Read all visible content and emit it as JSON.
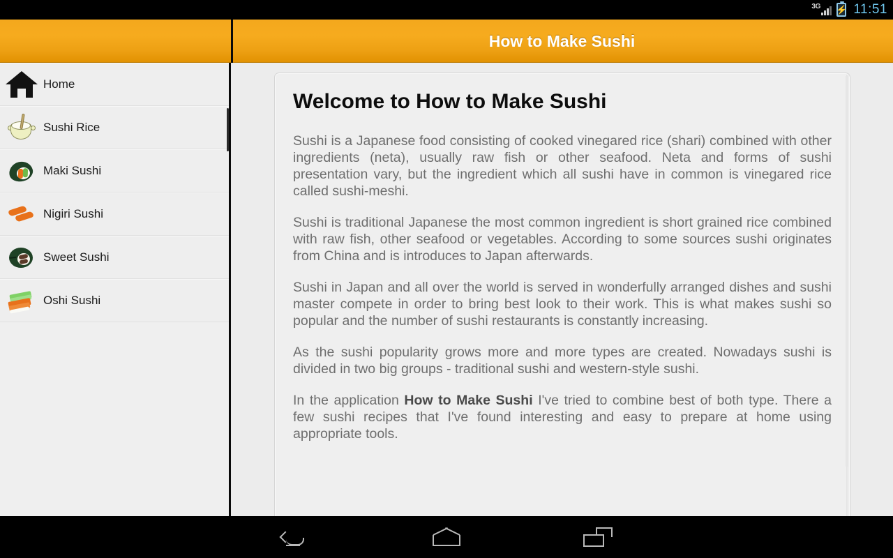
{
  "statusbar": {
    "network_label": "3G",
    "signal_icon": "signal-bars-icon",
    "battery_icon": "battery-charging-icon",
    "battery_bolt": "⚡",
    "time": "11:51"
  },
  "actionbar": {
    "title": "How to Make Sushi",
    "bg_color": "#f4a81d",
    "title_color": "#ffffff"
  },
  "drawer": {
    "items": [
      {
        "label": "Home",
        "icon": "home-icon"
      },
      {
        "label": "Sushi Rice",
        "icon": "rice-bowl-icon"
      },
      {
        "label": "Maki Sushi",
        "icon": "maki-roll-icon"
      },
      {
        "label": "Nigiri Sushi",
        "icon": "nigiri-salmon-icon"
      },
      {
        "label": "Sweet Sushi",
        "icon": "sweet-roll-icon"
      },
      {
        "label": "Oshi Sushi",
        "icon": "oshi-layers-icon"
      }
    ]
  },
  "main": {
    "doc_title": "Welcome to How to Make Sushi",
    "paragraphs": [
      "Sushi is a Japanese food consisting of cooked vinegared rice (shari) combined with other ingredients (neta), usually raw fish or other seafood. Neta and forms of sushi presentation vary, but the ingredient which all sushi have in common is vinegared rice called sushi-meshi.",
      "Sushi is traditional Japanese the most common ingredient is short grained rice combined with raw fish, other seafood or vegetables. According to some sources sushi originates from China and is introduces to Japan afterwards.",
      "Sushi in Japan and all over the world is served in wonderfully arranged dishes and sushi master compete in order to bring best look to their work. This is what makes sushi so popular and the number of sushi restaurants is constantly increasing.",
      "As the sushi popularity grows more and more types are created. Nowadays sushi is divided in two big groups - traditional sushi and western-style sushi."
    ],
    "last_paragraph": {
      "before": "In the application ",
      "bold": "How to Make Sushi",
      "after": " I've tried to combine best of both type. There a few sushi recipes that I've found interesting and easy to prepare at home using appropriate tools."
    }
  },
  "navbar": {
    "back_icon": "back-arrow-icon",
    "home_icon": "home-pentagon-icon",
    "recents_icon": "recent-apps-icon"
  }
}
